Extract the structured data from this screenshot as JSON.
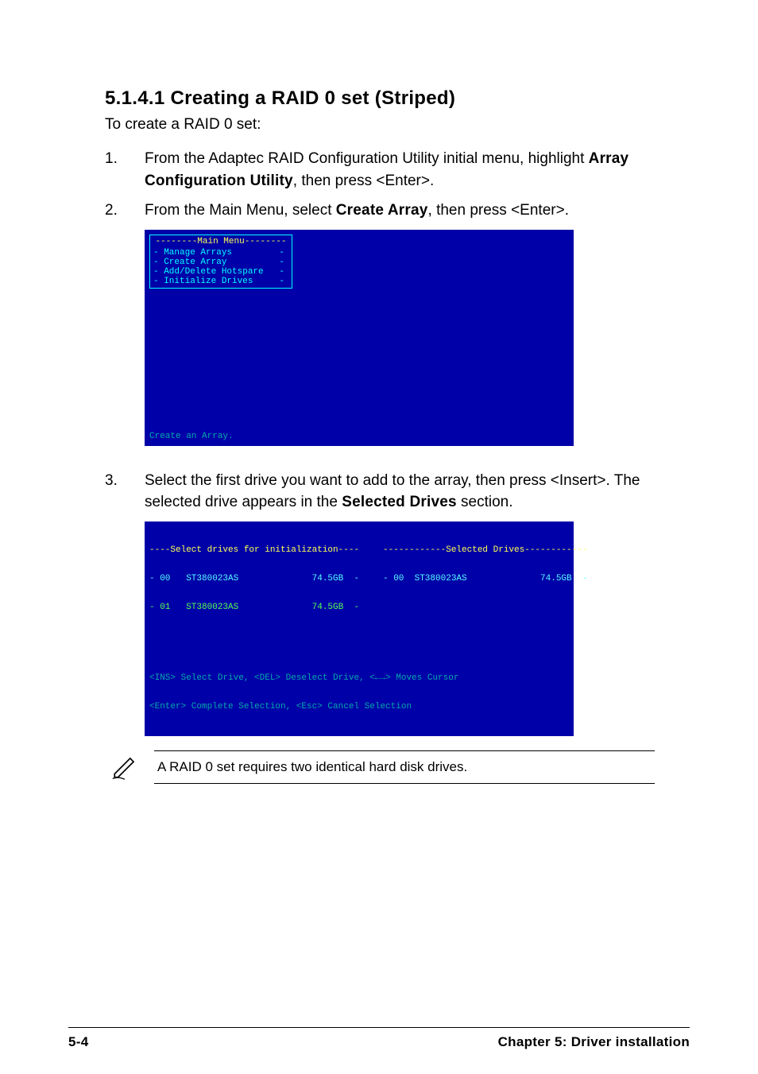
{
  "heading": "5.1.4.1 Creating a RAID 0 set (Striped)",
  "intro": "To create a RAID 0 set:",
  "steps": {
    "s1": {
      "num": "1.",
      "pre": "From the Adaptec RAID Configuration Utility initial menu, highlight ",
      "bold": "Array Configuration Utility",
      "post": ", then press <Enter>."
    },
    "s2": {
      "num": "2.",
      "pre": "From the Main Menu, select ",
      "bold": "Create Array",
      "post": ", then press <Enter>."
    },
    "s3": {
      "num": "3.",
      "pre": "Select the first drive you want to add to the array, then press <Insert>. The selected drive appears in the ",
      "bold": "Selected Drives",
      "post": " section."
    }
  },
  "bios1": {
    "title": "--------Main Menu--------",
    "items": [
      "- Manage Arrays         -",
      "- Create Array          -",
      "- Add/Delete Hotspare   -",
      "- Initialize Drives     -"
    ],
    "status": "Create an Array."
  },
  "bios2": {
    "left_header": "----Select drives for initialization----",
    "right_header": "------------Selected Drives------------",
    "left_rows": [
      "- 00   ST380023AS              74.5GB  -",
      "- 01   ST380023AS              74.5GB  -"
    ],
    "right_rows": [
      "- 00  ST380023AS              74.5GB  -"
    ],
    "footer_l1": "<INS> Select Drive, <DEL> Deselect Drive, <←→> Moves Cursor",
    "footer_l2": "<Enter> Complete Selection, <Esc> Cancel Selection"
  },
  "note": "A RAID 0 set requires two identical hard disk drives.",
  "footer": {
    "page": "5-4",
    "chapter": "Chapter 5:  Driver installation"
  }
}
